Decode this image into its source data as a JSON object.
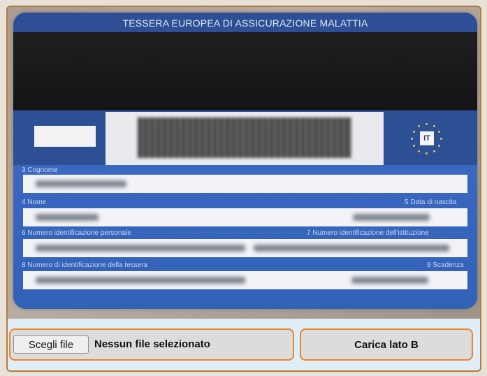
{
  "card": {
    "header": "TESSERA EUROPEA DI ASSICURAZIONE MALATTIA",
    "country_code": "IT",
    "fields": [
      {
        "label": "3 Cognome"
      },
      {
        "label": "4 Nome"
      },
      {
        "label": "5 Data di nascita"
      },
      {
        "label": "6 Numero identificazione personale"
      },
      {
        "label": "7 Numero identificazione dell'istituzione"
      },
      {
        "label": "8 Numero di identificazione della tessera"
      },
      {
        "label": "9 Scadenza"
      }
    ]
  },
  "file_input": {
    "button_label": "Scegli file",
    "status": "Nessun file selezionato"
  },
  "upload_button": {
    "label": "Carica lato B"
  },
  "colors": {
    "accent_border": "#e8872e",
    "card_blue": "#2b55a8"
  }
}
